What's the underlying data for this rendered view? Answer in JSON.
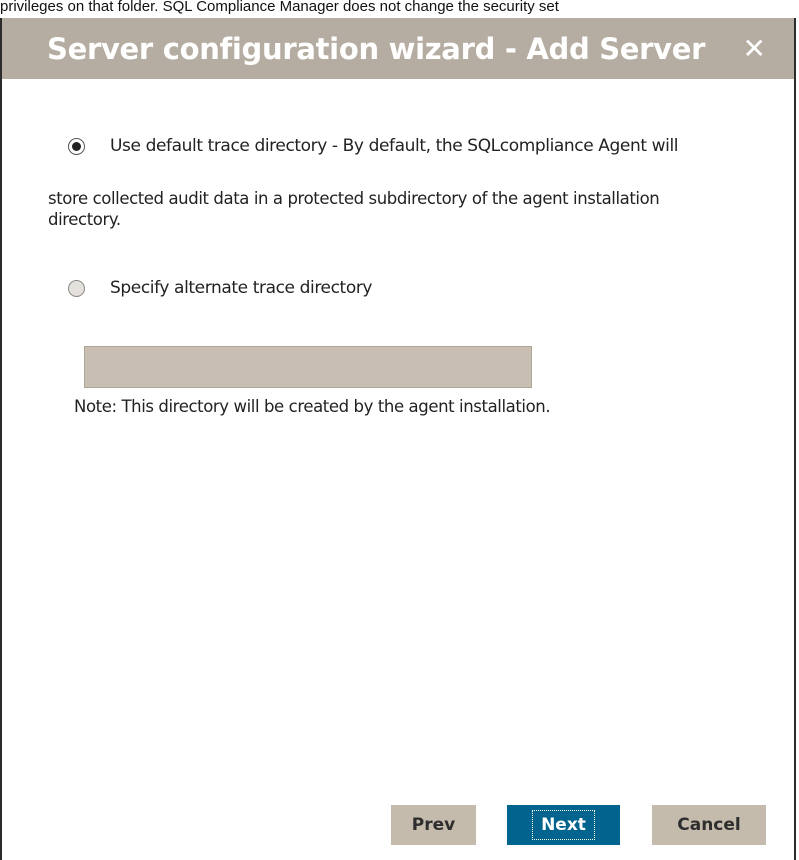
{
  "doc_snippet": "privileges on that folder. SQL Compliance Manager does not change the security set",
  "dialog": {
    "title": "Server configuration wizard - Add Server",
    "close_glyph": "✕"
  },
  "options": {
    "default_label": "Use default trace directory - By default, the SQLcompliance Agent will",
    "default_description": "store collected audit data in a protected subdirectory of the agent installation directory.",
    "alternate_label": "Specify alternate trace directory",
    "selected": "default"
  },
  "directory_input": {
    "value": "",
    "placeholder": ""
  },
  "note": "Note: This directory will be created by the agent installation.",
  "buttons": {
    "prev": "Prev",
    "next": "Next",
    "cancel": "Cancel"
  },
  "colors": {
    "titlebar": "#b6ada2",
    "primary_button": "#00648f",
    "secondary_button": "#c4bbac",
    "input_background": "#c8bfb2"
  },
  "icons": {
    "close": "close-icon"
  }
}
